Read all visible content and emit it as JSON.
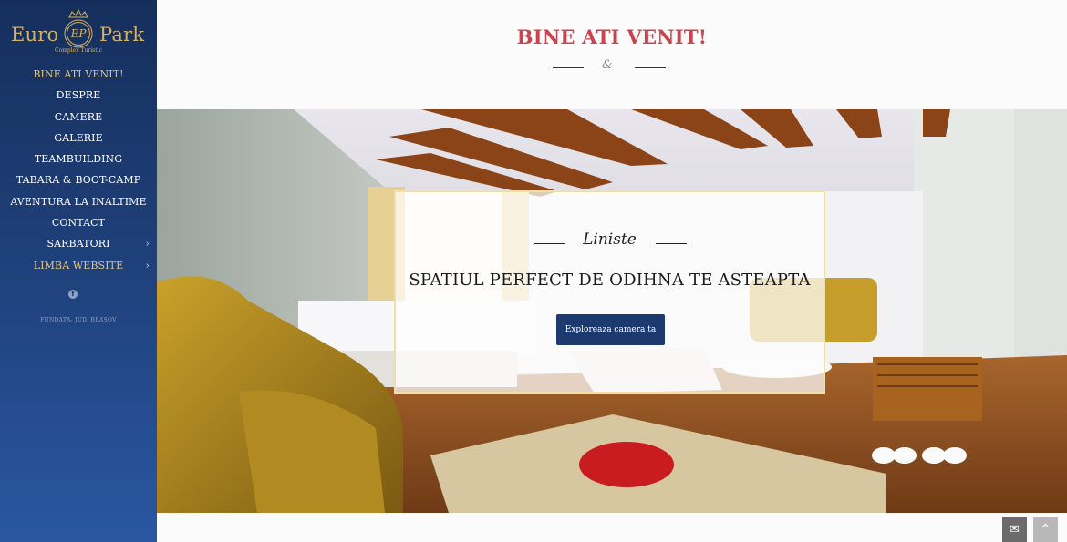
{
  "brand": {
    "word1": "Euro",
    "word2": "Park",
    "monogram": "EP",
    "tagline": "Complex Turistic"
  },
  "nav": {
    "items": [
      {
        "label": "BINE ATI VENIT!",
        "active": true
      },
      {
        "label": "DESPRE"
      },
      {
        "label": "CAMERE"
      },
      {
        "label": "GALERIE"
      },
      {
        "label": "TEAMBUILDING"
      },
      {
        "label": "TABARA & BOOT-CAMP"
      },
      {
        "label": "AVENTURA LA INALTIME"
      },
      {
        "label": "CONTACT"
      },
      {
        "label": "SARBATORI",
        "submenu": true
      },
      {
        "label": "LIMBA WEBSITE",
        "submenu": true
      }
    ],
    "chevron": "›"
  },
  "social": {
    "facebook_icon": "f"
  },
  "address": "FUNDATA- JUD. BRASOV",
  "header": {
    "title": "BINE ATI VENIT!",
    "ornament": "&"
  },
  "hero": {
    "script_title": "Liniste",
    "headline": "SPATIUL PERFECT DE ODIHNA TE ASTEAPTA",
    "button_label": "Exploreaza camera ta"
  },
  "fabs": {
    "mail_icon": "✉",
    "top_icon": "^"
  },
  "colors": {
    "sidebar_top": "#152f5c",
    "sidebar_bottom": "#2a56a1",
    "gold": "#d4b068",
    "title_red": "#c9444f",
    "button": "#1d3a6e"
  }
}
